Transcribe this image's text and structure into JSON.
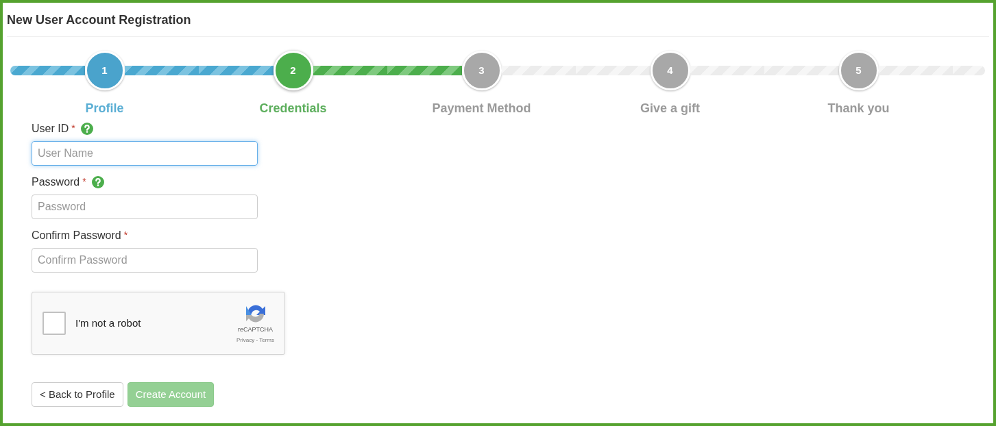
{
  "title": "New User Account Registration",
  "steps": [
    {
      "number": "1",
      "label": "Profile",
      "done": true,
      "selected": false
    },
    {
      "number": "2",
      "label": "Credentials",
      "done": false,
      "selected": true
    },
    {
      "number": "3",
      "label": "Payment Method",
      "done": false,
      "selected": false
    },
    {
      "number": "4",
      "label": "Give a gift",
      "done": false,
      "selected": false
    },
    {
      "number": "5",
      "label": "Thank you",
      "done": false,
      "selected": false
    }
  ],
  "fields": [
    {
      "label": "User ID",
      "required": "*",
      "help": true,
      "placeholder": "User Name",
      "focused": true
    },
    {
      "label": "Password",
      "required": "*",
      "help": true,
      "placeholder": "Password",
      "focused": false
    },
    {
      "label": "Confirm Password",
      "required": "*",
      "help": false,
      "placeholder": "Confirm Password",
      "focused": false
    }
  ],
  "captcha": {
    "label": "I'm not a robot",
    "checked": false,
    "brand": "reCAPTCHA",
    "links": "Privacy - Terms"
  },
  "buttons": [
    {
      "label": "< Back to Profile",
      "kind": "secondary",
      "disabled": false
    },
    {
      "label": "Create Account",
      "kind": "primary",
      "disabled": true
    }
  ]
}
